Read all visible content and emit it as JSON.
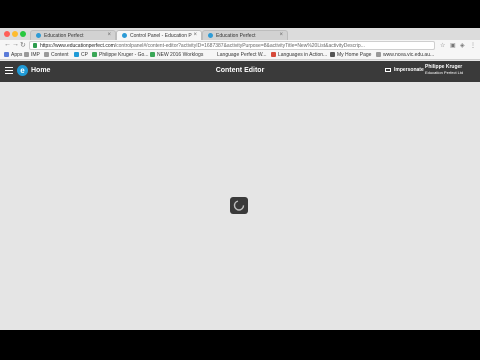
{
  "browser": {
    "tabs": [
      {
        "label": "Education Perfect"
      },
      {
        "label": "Control Panel - Education Perfect"
      },
      {
        "label": "Education Perfect"
      }
    ],
    "url_host": "https://www.educationperfect.com",
    "url_path": "/controlpanel#/content-editor?activityID=1687387&activityPurpose=8&activityTitle=New%20List&activityDescrip..."
  },
  "bookmarks": [
    {
      "label": "Apps"
    },
    {
      "label": "IMP"
    },
    {
      "label": "Content"
    },
    {
      "label": "CP"
    },
    {
      "label": "Philippe Kruger - Go..."
    },
    {
      "label": "NEW 2016 Worklogs"
    },
    {
      "label": "Language Perfect W..."
    },
    {
      "label": "Languages in Action..."
    },
    {
      "label": "My Home Page"
    },
    {
      "label": "www.ncea.vic.edu.au..."
    }
  ],
  "app": {
    "home_label": "Home",
    "title": "Content Editor",
    "impersonate_label": "Impersonate",
    "user_name": "Philippe Kruger",
    "user_org": "Education Perfect Ltd",
    "logo_letter": "e"
  },
  "colors": {
    "header_bg": "#3a3a3a",
    "brand_blue": "#1f9ad6",
    "canvas_bg": "#e5e5e5"
  }
}
